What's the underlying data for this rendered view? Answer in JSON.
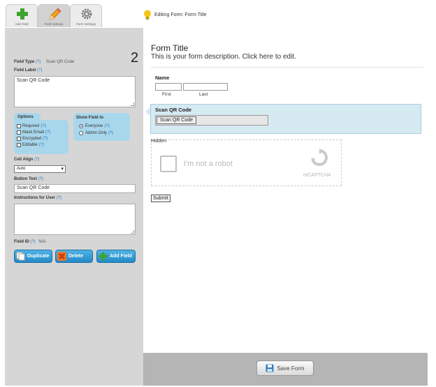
{
  "tabs": [
    {
      "label": "Add Field",
      "icon": "plus-icon",
      "active": false
    },
    {
      "label": "Field Settings",
      "icon": "pencil-icon",
      "active": true
    },
    {
      "label": "Form Settings",
      "icon": "gear-icon",
      "active": false
    }
  ],
  "editing_title": "Editing Form: Form Title",
  "settings": {
    "field_type_label": "Field Type",
    "field_type_value": "Scan QR Code",
    "help": "(?)",
    "number_marker": "2",
    "field_label_label": "Field Label",
    "field_label_value": "Scan QR Code",
    "options_title": "Options",
    "options": [
      {
        "label": "Required",
        "checked": false
      },
      {
        "label": "Mask Email",
        "checked": false
      },
      {
        "label": "Encrypted",
        "checked": false
      },
      {
        "label": "Editable",
        "checked": false
      }
    ],
    "show_field_title": "Show Field to",
    "show_field_options": [
      {
        "label": "Everyone",
        "selected": true
      },
      {
        "label": "Admin Only",
        "selected": false
      }
    ],
    "cell_align_label": "Cell Align",
    "cell_align_value": "Auto",
    "button_text_label": "Button Text",
    "button_text_value": "Scan QR Code",
    "instructions_label": "Instructions for User",
    "instructions_value": "",
    "field_id_label": "Field ID",
    "field_id_value": "N/A",
    "buttons": {
      "duplicate": "Duplicate",
      "delete": "Delete",
      "add_field": "Add Field"
    }
  },
  "form": {
    "title": "Form Title",
    "description": "This is your form description. Click here to edit.",
    "name_label": "Name",
    "first_label": "First",
    "last_label": "Last",
    "qr_label": "Scan QR Code",
    "qr_button": "Scan QR Code",
    "hidden_label": "Hidden",
    "captcha_text": "I'm not a robot",
    "captcha_brand": "reCAPTCHA",
    "submit_label": "Submit"
  },
  "save_button": "Save Form",
  "colors": {
    "accent_blue": "#2489c6",
    "options_bg": "#a8d7ec",
    "left_bg": "#d6d6d6",
    "selected_field_bg": "#d6eaf2"
  }
}
